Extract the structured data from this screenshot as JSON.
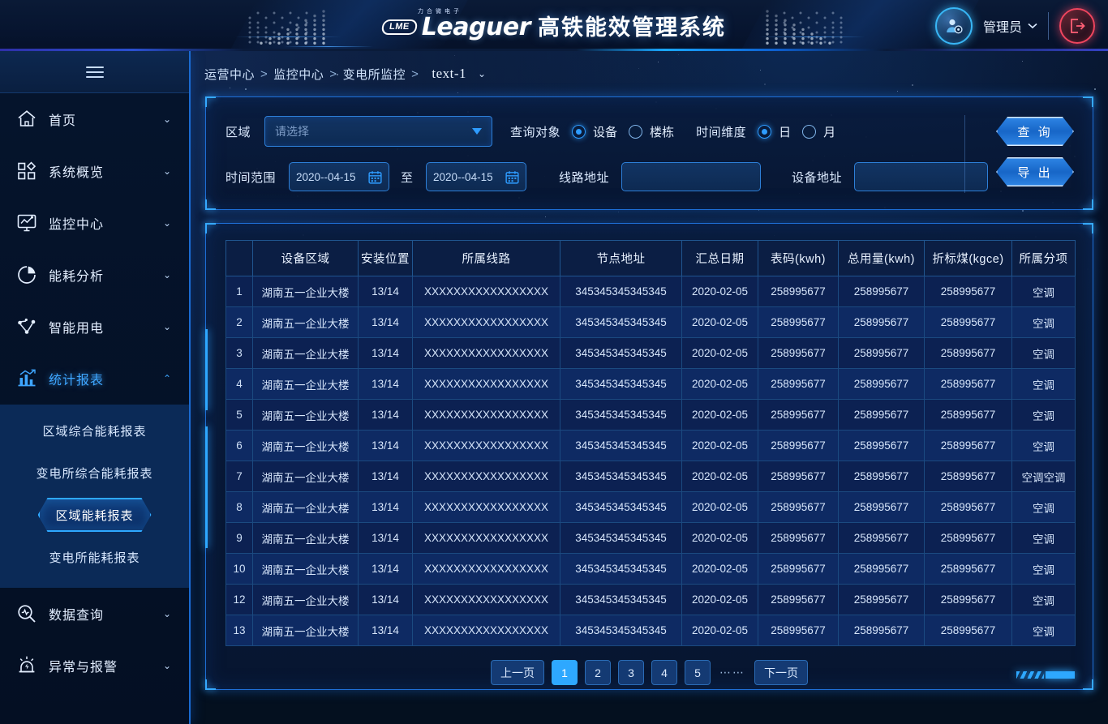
{
  "header": {
    "logo_badge": "LME",
    "logo_word": "Leaguer",
    "logo_cn_small": "力合微电子",
    "title": "高铁能效管理系统",
    "user_name": "管理员",
    "user_caret": "⌄",
    "avatar_icon": "user-gear-icon",
    "logout_icon": "logout-icon"
  },
  "sidebar": {
    "menu_icon": "hamburger-icon",
    "items": [
      {
        "label": "首页",
        "icon": "home-icon",
        "chevron": "⌄",
        "expanded": false
      },
      {
        "label": "系统概览",
        "icon": "grid-icon",
        "chevron": "⌄",
        "expanded": false
      },
      {
        "label": "监控中心",
        "icon": "monitor-icon",
        "chevron": "⌄",
        "expanded": false
      },
      {
        "label": "能耗分析",
        "icon": "pie-chart-icon",
        "chevron": "⌄",
        "expanded": false
      },
      {
        "label": "智能用电",
        "icon": "network-icon",
        "chevron": "⌄",
        "expanded": false
      },
      {
        "label": "统计报表",
        "icon": "bar-chart-icon",
        "chevron": "⌃",
        "expanded": true
      },
      {
        "label": "数据查询",
        "icon": "search-pulse-icon",
        "chevron": "⌄",
        "expanded": false
      },
      {
        "label": "异常与报警",
        "icon": "alarm-icon",
        "chevron": "⌄",
        "expanded": false
      }
    ],
    "submenu": [
      {
        "label": "区域综合能耗报表",
        "selected": false
      },
      {
        "label": "变电所综合能耗报表",
        "selected": false
      },
      {
        "label": "区域能耗报表",
        "selected": true
      },
      {
        "label": "变电所能耗报表",
        "selected": false
      }
    ]
  },
  "breadcrumb": {
    "segments": [
      "运营中心",
      "监控中心",
      "变电所监控"
    ],
    "separator": ">",
    "current": "text-1",
    "dropdown_icon": "⌄"
  },
  "filters": {
    "area_label": "区域",
    "area_placeholder": "请选择",
    "area_value": "",
    "dropdown_icon": "chevron-down-icon",
    "object_label": "查询对象",
    "object_options": [
      {
        "label": "设备",
        "selected": true
      },
      {
        "label": "楼栋",
        "selected": false
      }
    ],
    "dimension_label": "时间维度",
    "dimension_options": [
      {
        "label": "日",
        "selected": true
      },
      {
        "label": "月",
        "selected": false
      }
    ],
    "time_range_label": "时间范围",
    "date_from": "2020--04-15",
    "date_to": "2020--04-15",
    "date_sep": "至",
    "calendar_icon": "calendar-icon",
    "line_addr_label": "线路地址",
    "line_addr_value": "",
    "device_addr_label": "设备地址",
    "device_addr_value": "",
    "query_button": "查 询",
    "export_button": "导 出"
  },
  "table": {
    "columns": [
      "",
      "设备区域",
      "安装位置",
      "所属线路",
      "节点地址",
      "汇总日期",
      "表码(kwh)",
      "总用量(kwh)",
      "折标煤(kgce)",
      "所属分项"
    ],
    "rows": [
      [
        "1",
        "湖南五一企业大楼",
        "13/14",
        "XXXXXXXXXXXXXXXXX",
        "345345345345345",
        "2020-02-05",
        "258995677",
        "258995677",
        "258995677",
        "空调"
      ],
      [
        "2",
        "湖南五一企业大楼",
        "13/14",
        "XXXXXXXXXXXXXXXXX",
        "345345345345345",
        "2020-02-05",
        "258995677",
        "258995677",
        "258995677",
        "空调"
      ],
      [
        "3",
        "湖南五一企业大楼",
        "13/14",
        "XXXXXXXXXXXXXXXXX",
        "345345345345345",
        "2020-02-05",
        "258995677",
        "258995677",
        "258995677",
        "空调"
      ],
      [
        "4",
        "湖南五一企业大楼",
        "13/14",
        "XXXXXXXXXXXXXXXXX",
        "345345345345345",
        "2020-02-05",
        "258995677",
        "258995677",
        "258995677",
        "空调"
      ],
      [
        "5",
        "湖南五一企业大楼",
        "13/14",
        "XXXXXXXXXXXXXXXXX",
        "345345345345345",
        "2020-02-05",
        "258995677",
        "258995677",
        "258995677",
        "空调"
      ],
      [
        "6",
        "湖南五一企业大楼",
        "13/14",
        "XXXXXXXXXXXXXXXXX",
        "345345345345345",
        "2020-02-05",
        "258995677",
        "258995677",
        "258995677",
        "空调"
      ],
      [
        "7",
        "湖南五一企业大楼",
        "13/14",
        "XXXXXXXXXXXXXXXXX",
        "345345345345345",
        "2020-02-05",
        "258995677",
        "258995677",
        "258995677",
        "空调空调"
      ],
      [
        "8",
        "湖南五一企业大楼",
        "13/14",
        "XXXXXXXXXXXXXXXXX",
        "345345345345345",
        "2020-02-05",
        "258995677",
        "258995677",
        "258995677",
        "空调"
      ],
      [
        "9",
        "湖南五一企业大楼",
        "13/14",
        "XXXXXXXXXXXXXXXXX",
        "345345345345345",
        "2020-02-05",
        "258995677",
        "258995677",
        "258995677",
        "空调"
      ],
      [
        "10",
        "湖南五一企业大楼",
        "13/14",
        "XXXXXXXXXXXXXXXXX",
        "345345345345345",
        "2020-02-05",
        "258995677",
        "258995677",
        "258995677",
        "空调"
      ],
      [
        "12",
        "湖南五一企业大楼",
        "13/14",
        "XXXXXXXXXXXXXXXXX",
        "345345345345345",
        "2020-02-05",
        "258995677",
        "258995677",
        "258995677",
        "空调"
      ],
      [
        "13",
        "湖南五一企业大楼",
        "13/14",
        "XXXXXXXXXXXXXXXXX",
        "345345345345345",
        "2020-02-05",
        "258995677",
        "258995677",
        "258995677",
        "空调"
      ]
    ]
  },
  "pagination": {
    "prev": "上一页",
    "next": "下一页",
    "pages": [
      "1",
      "2",
      "3",
      "4",
      "5"
    ],
    "current": "1",
    "ellipsis": "⋯⋯"
  },
  "colors": {
    "accent": "#2ea8ff",
    "panel_border": "#1f6fd6",
    "header_bg": "#071530",
    "sidebar_bg": "#05142c",
    "submenu_bg": "#0b2a57",
    "row_odd": "#0e2a63",
    "row_even": "#0c2152",
    "logout_red": "#f0455e"
  }
}
